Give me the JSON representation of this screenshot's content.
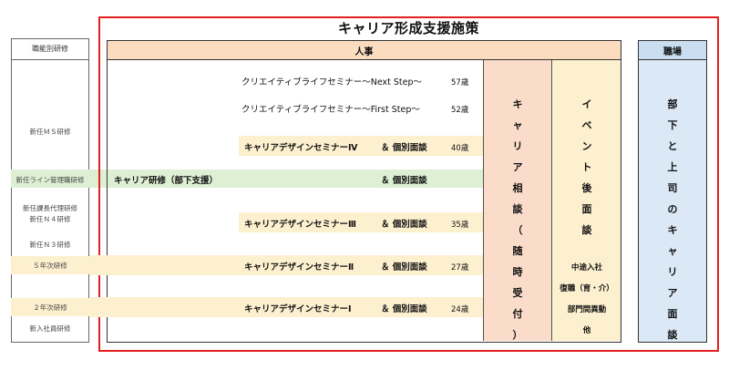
{
  "title": "キャリア形成支援施策",
  "left_panel": {
    "header": "職能別研修",
    "items": [
      "新任ＭＳ研修",
      "新任ライン管理職研修",
      "新任課長代理研修",
      "新任Ｎ４研修",
      "新任Ｎ３研修",
      "５年次研修",
      "２年次研修",
      "新入社員研修"
    ]
  },
  "hr": {
    "header": "人事",
    "seminars": {
      "next_step": "クリエイティブライフセミナー～Next Step～",
      "first_step": "クリエイティブライフセミナー～First Step～",
      "design4": "キャリアデザインセミナーⅣ",
      "support": "キャリア研修（部下支援）",
      "design3": "キャリアデザインセミナーⅢ",
      "design2": "キャリアデザインセミナーⅡ",
      "design1": "キャリアデザインセミナーⅠ"
    },
    "interview": "＆ 個別面談",
    "ages": {
      "next_step": "57歳",
      "first_step": "52歳",
      "design4": "40歳",
      "design3": "35歳",
      "design2": "27歳",
      "design1": "24歳"
    },
    "consultation": [
      "キ",
      "ャ",
      "リ",
      "ア",
      "相",
      "談",
      "（",
      "随",
      "時",
      "受",
      "付",
      "）"
    ],
    "event": {
      "title": [
        "イ",
        "ベ",
        "ン",
        "ト",
        "後",
        "面",
        "談"
      ],
      "items": [
        "中途入社",
        "復職（育・介）",
        "部門間異動",
        "他"
      ]
    }
  },
  "workplace": {
    "header": "職場",
    "text": [
      "部",
      "下",
      "と",
      "上",
      "司",
      "の",
      "キ",
      "ャ",
      "リ",
      "ア",
      "面",
      "談"
    ]
  },
  "colors": {
    "frame": "#e41f1f",
    "hr_header": "#fbdcbf",
    "band_yellow": "#fdf0cf",
    "band_green": "#def0d4",
    "consult": "#fbdcca",
    "workplace": "#dbe8f5"
  }
}
